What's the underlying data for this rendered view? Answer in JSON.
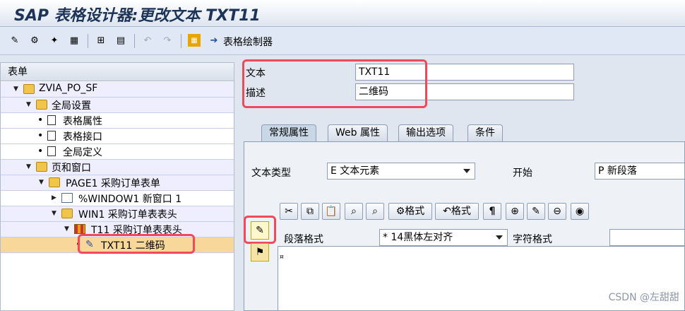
{
  "window": {
    "title": "SAP 表格设计器:更改文本 TXT11"
  },
  "toolbar": {
    "form_painter_label": "表格绘制器"
  },
  "left": {
    "header": "表单",
    "tree": [
      {
        "label": "ZVIA_PO_SF"
      },
      {
        "label": "全局设置"
      },
      {
        "label": "表格属性"
      },
      {
        "label": "表格接口"
      },
      {
        "label": "全局定义"
      },
      {
        "label": "页和窗口"
      },
      {
        "label": "PAGE1 采购订单表单"
      },
      {
        "label": "%WINDOW1 新窗口 1"
      },
      {
        "label": "WIN1 采购订单表表头"
      },
      {
        "label": "T11 采购订单表表头"
      },
      {
        "label": "TXT11 二维码"
      }
    ]
  },
  "main": {
    "text_label": "文本",
    "text_value": "TXT11",
    "desc_label": "描述",
    "desc_value": "二维码",
    "tabs": [
      "常规属性",
      "Web 属性",
      "输出选项",
      "条件"
    ],
    "text_type_label": "文本类型",
    "text_type_value": "E 文本元素",
    "start_label": "开始",
    "start_value": "P 新段落",
    "editor_buttons": {
      "format1": "格式",
      "format2": "格式",
      "para": "¶"
    },
    "para_format_label": "段落格式",
    "para_format_value": "* 14黑体左对齐",
    "char_format_label": "字符格式"
  },
  "watermark": "CSDN @左甜甜",
  "colors": {
    "highlight": "#f04a5a",
    "selected_row": "#f8d79b"
  }
}
